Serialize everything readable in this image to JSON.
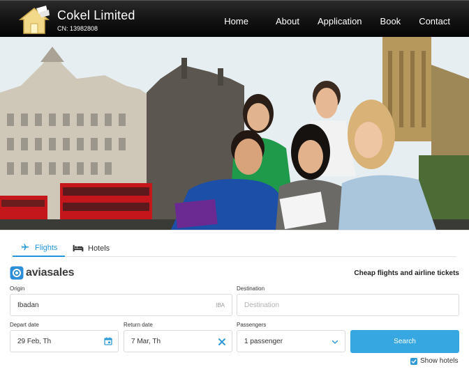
{
  "header": {
    "brand_name": "Cokel Limited",
    "brand_sub": "CN: 13982808",
    "nav": [
      "Home",
      "About",
      "Application",
      "Book",
      "Contact"
    ]
  },
  "hero": {
    "description_icon": "hero-photo"
  },
  "widget": {
    "tabs": [
      {
        "label": "Flights",
        "icon": "airplane-icon",
        "active": true
      },
      {
        "label": "Hotels",
        "icon": "bed-icon",
        "active": false
      }
    ],
    "provider": "aviasales",
    "tagline": "Cheap flights and airline tickets",
    "origin": {
      "label": "Origin",
      "value": "Ibadan",
      "code": "IBA"
    },
    "destination": {
      "label": "Destination",
      "placeholder": "Destination"
    },
    "depart": {
      "label": "Depart date",
      "value": "29 Feb, Th"
    },
    "return": {
      "label": "Return date",
      "value": "7 Mar, Th"
    },
    "passengers": {
      "label": "Passengers",
      "value": "1 passenger"
    },
    "search_label": "Search",
    "show_hotels_label": "Show hotels",
    "show_hotels_checked": true
  },
  "colors": {
    "accent": "#36a7e0",
    "tab_active": "#2196d8",
    "header_bg": "#111111"
  }
}
